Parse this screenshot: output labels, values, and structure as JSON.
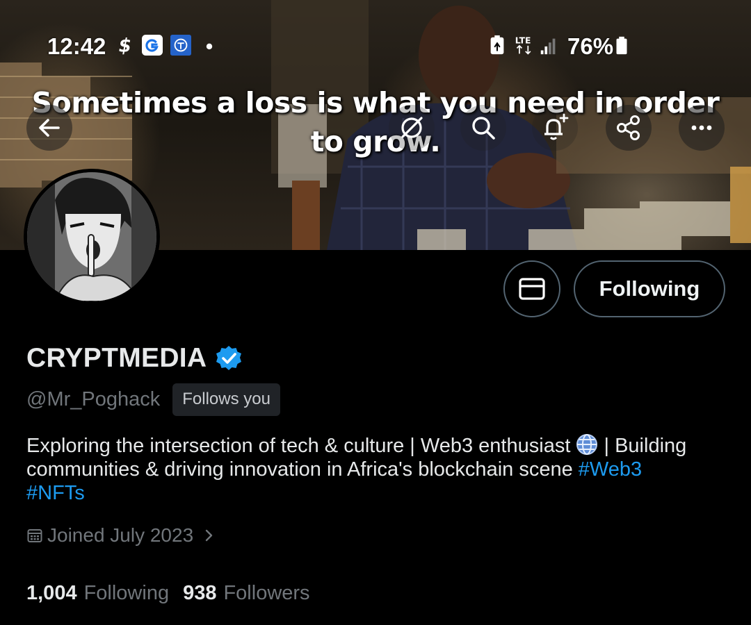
{
  "status_bar": {
    "time": "12:42",
    "battery": "76%",
    "network": "LTE"
  },
  "banner": {
    "caption_line1": "Sometimes a loss is what you need in order",
    "caption_line2": "to grow."
  },
  "toolbar": {
    "back_icon": "arrow-left-icon",
    "grok_icon": "grok-icon",
    "search_icon": "search-icon",
    "notify_icon": "bell-plus-icon",
    "share_icon": "share-icon",
    "more_icon": "more-horizontal-icon"
  },
  "actions": {
    "message_icon": "mail-icon",
    "follow_label": "Following"
  },
  "profile": {
    "name": "CRYPTMEDIA",
    "handle": "@Mr_Poghack",
    "follows_you": "Follows you",
    "bio_part1": "Exploring the intersection of tech & culture | Web3 enthusiast ",
    "bio_part2": " | Building communities & driving innovation in Africa's blockchain scene ",
    "bio_tag1": "#Web3",
    "bio_tag2": "#NFTs",
    "joined": "Joined July 2023",
    "following_count": "1,004",
    "following_label": "Following",
    "followers_count": "938",
    "followers_label": "Followers"
  },
  "colors": {
    "background": "#000000",
    "accent": "#1d9bf0",
    "muted": "#71767b",
    "verified": "#1d9bf0"
  }
}
